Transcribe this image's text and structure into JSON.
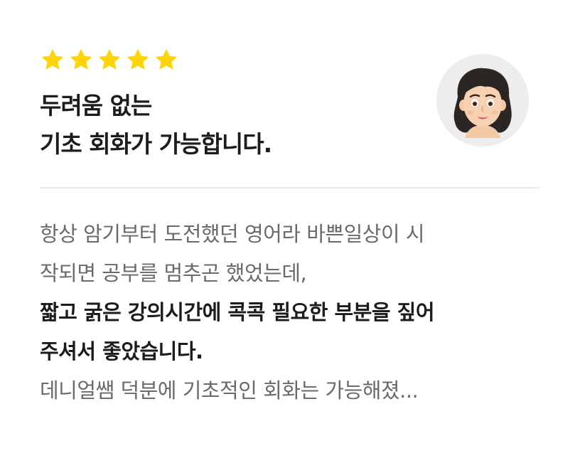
{
  "rating": {
    "stars": 5,
    "max": 5,
    "color": "#FFD400"
  },
  "review": {
    "title_lines": [
      "두려움 없는",
      "기초 회화가 가능합니다."
    ],
    "body_lines": [
      {
        "text": "항상 암기부터 도전했던 영어라 바쁜일상이 시",
        "style": "normal"
      },
      {
        "text": "작되면 공부를 멈추곤 했었는데,",
        "style": "normal"
      },
      {
        "text": "짧고 굵은 강의시간에 콕콕 필요한 부분을 짚어",
        "style": "bold"
      },
      {
        "text": "주셔서 좋았습니다.",
        "style": "bold"
      },
      {
        "text": "데니얼쌤 덕분에 기초적인 회화는 가능해졌...",
        "style": "normal"
      }
    ]
  },
  "avatar": {
    "icon": "woman-avatar-icon",
    "background": "#EDEDED"
  },
  "colors": {
    "divider": "#E9E9E9",
    "title": "#1C1C1C",
    "body_muted": "#6A6A6A"
  }
}
